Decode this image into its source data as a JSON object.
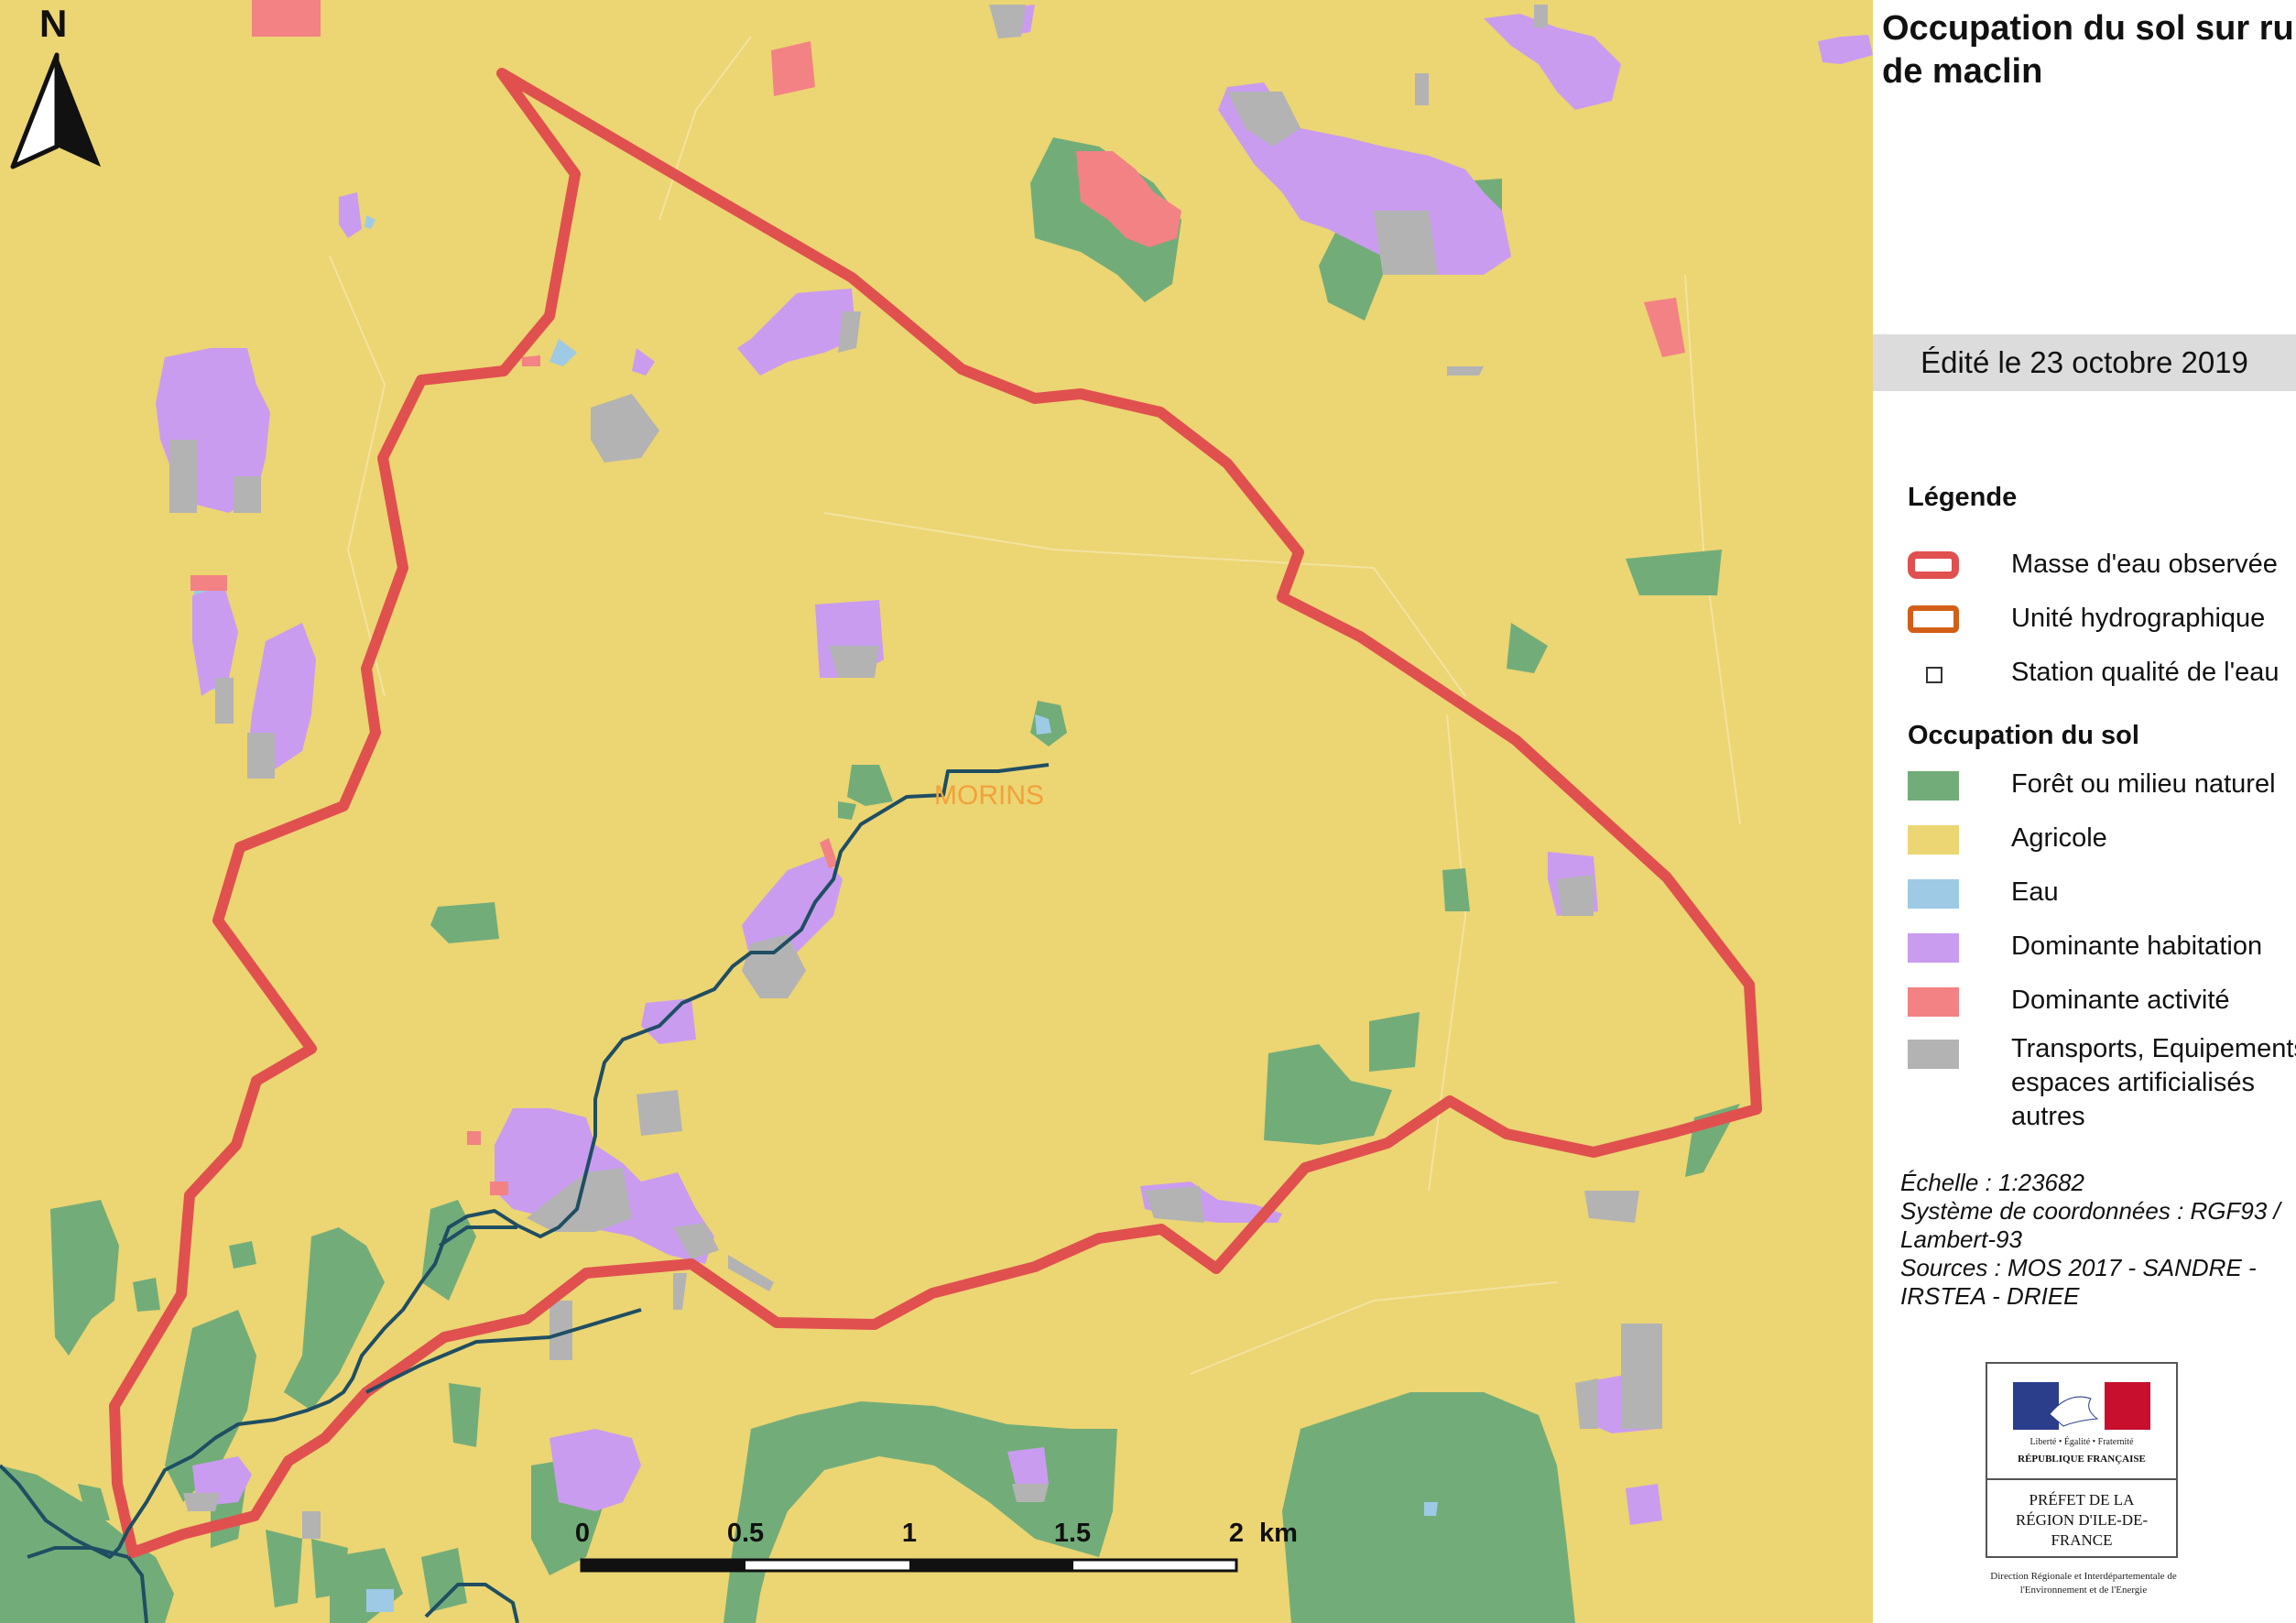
{
  "map": {
    "north_label": "N",
    "river_label": "MORINS",
    "scale_bar": {
      "ticks": [
        "0",
        "0.5",
        "1",
        "1.5",
        "2"
      ],
      "unit": "km"
    },
    "colors": {
      "agricultural": "#ecd573",
      "forest": "#72ad79",
      "water": "#9ecae6",
      "habitation": "#c99cf0",
      "activity": "#f28284",
      "transport": "#b3b3b3",
      "observed_water_body": "#e0504f",
      "river_line": "#1f4e63",
      "river_label": "#f2a23c"
    }
  },
  "panel": {
    "title": "Occupation du sol sur ru de maclin",
    "edited": "Édité le 23 octobre 2019",
    "legend_heading": "Légende",
    "legend_items": [
      {
        "label": "Masse d'eau observée",
        "icon": "outline-red"
      },
      {
        "label": "Unité hydrographique",
        "icon": "outline-orange"
      },
      {
        "label": "Station qualité de l'eau",
        "icon": "small-square"
      }
    ],
    "landuse_heading": "Occupation du sol",
    "landuse_items": [
      {
        "label": "Forêt ou milieu naturel",
        "color": "#72ad79"
      },
      {
        "label": "Agricole",
        "color": "#ecd573"
      },
      {
        "label": "Eau",
        "color": "#9ecae6"
      },
      {
        "label": "Dominante habitation",
        "color": "#c99cf0"
      },
      {
        "label": "Dominante activité",
        "color": "#f28284"
      },
      {
        "label": "Transports, Equipements, espaces artificialisés autres",
        "color": "#b3b3b3"
      }
    ],
    "scale_line": "Échelle :  1:23682",
    "crs_line": "Système de coordonnées : RGF93 / Lambert-93",
    "sources_line": "Sources : MOS 2017 - SANDRE - IRSTEA - DRIEE",
    "logo": {
      "motto": "Liberté • Égalité • Fraternité",
      "republic": "RÉPUBLIQUE FRANÇAISE",
      "prefet": "PRÉFET DE LA RÉGION D'ILE-DE-FRANCE",
      "direction": "Direction Régionale et Interdépartementale de l'Environnement et de l'Energie"
    }
  }
}
